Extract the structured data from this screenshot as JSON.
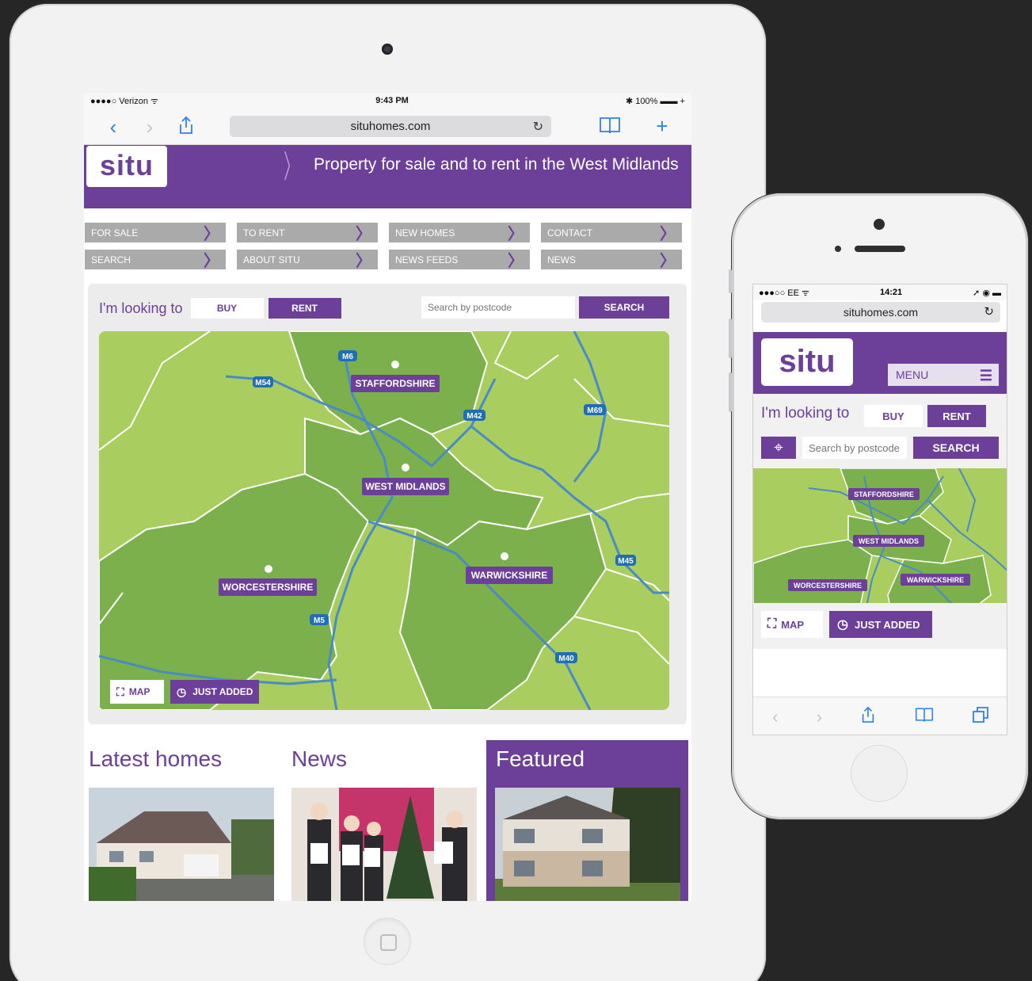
{
  "ipad": {
    "status": {
      "carrier": "●●●●○ Verizon ᯤ",
      "time": "9:43 PM",
      "battery": "✱ 100% ▬▬ +"
    },
    "safari": {
      "url": "situhomes.com"
    },
    "site": {
      "logo": "situ",
      "tagline": "Property for sale and to rent in the West Midlands",
      "menu": [
        "FOR SALE",
        "TO RENT",
        "NEW HOMES",
        "CONTACT",
        "SEARCH",
        "ABOUT SITU",
        "NEWS FEEDS",
        "NEWS"
      ],
      "looking_label": "I'm looking to",
      "buy": "BUY",
      "rent": "RENT",
      "postcode_placeholder": "Search by postcode",
      "search": "SEARCH",
      "map": {
        "regions": [
          "STAFFORDSHIRE",
          "WEST MIDLANDS",
          "WORCESTERSHIRE",
          "WARWICKSHIRE"
        ],
        "roads": [
          "M6",
          "M54",
          "M42",
          "M69",
          "M45",
          "M5",
          "M40"
        ]
      },
      "map_btn": "MAP",
      "just_added_btn": "JUST ADDED",
      "sections": {
        "latest": "Latest homes",
        "news": "News",
        "featured": "Featured"
      }
    }
  },
  "iphone": {
    "status": {
      "carrier": "●●●○○ EE ᯤ",
      "time": "14:21",
      "battery": "➚ ◉ ▬"
    },
    "url": "situhomes.com",
    "logo": "situ",
    "menu": "MENU",
    "looking_label": "I'm looking to",
    "buy": "BUY",
    "rent": "RENT",
    "postcode_placeholder": "Search by postcode",
    "search": "SEARCH",
    "map": {
      "regions": [
        "STAFFORDSHIRE",
        "WEST MIDLANDS",
        "WORCESTERSHIRE",
        "WARWICKSHIRE"
      ]
    },
    "map_btn": "MAP",
    "just_added_btn": "JUST ADDED"
  },
  "colors": {
    "brand_purple": "#6c3f99",
    "menu_grey": "#aaaaaa",
    "map_light": "#a9cd5e",
    "map_dark": "#7bb04d",
    "road": "#4a8bc6"
  },
  "icons": [
    "share-icon",
    "bookmarks-icon",
    "add-tab-icon",
    "reload-icon",
    "back-icon",
    "forward-icon",
    "tabs-icon",
    "expand-icon",
    "clock-icon",
    "locate-icon",
    "menu-lines-icon"
  ]
}
